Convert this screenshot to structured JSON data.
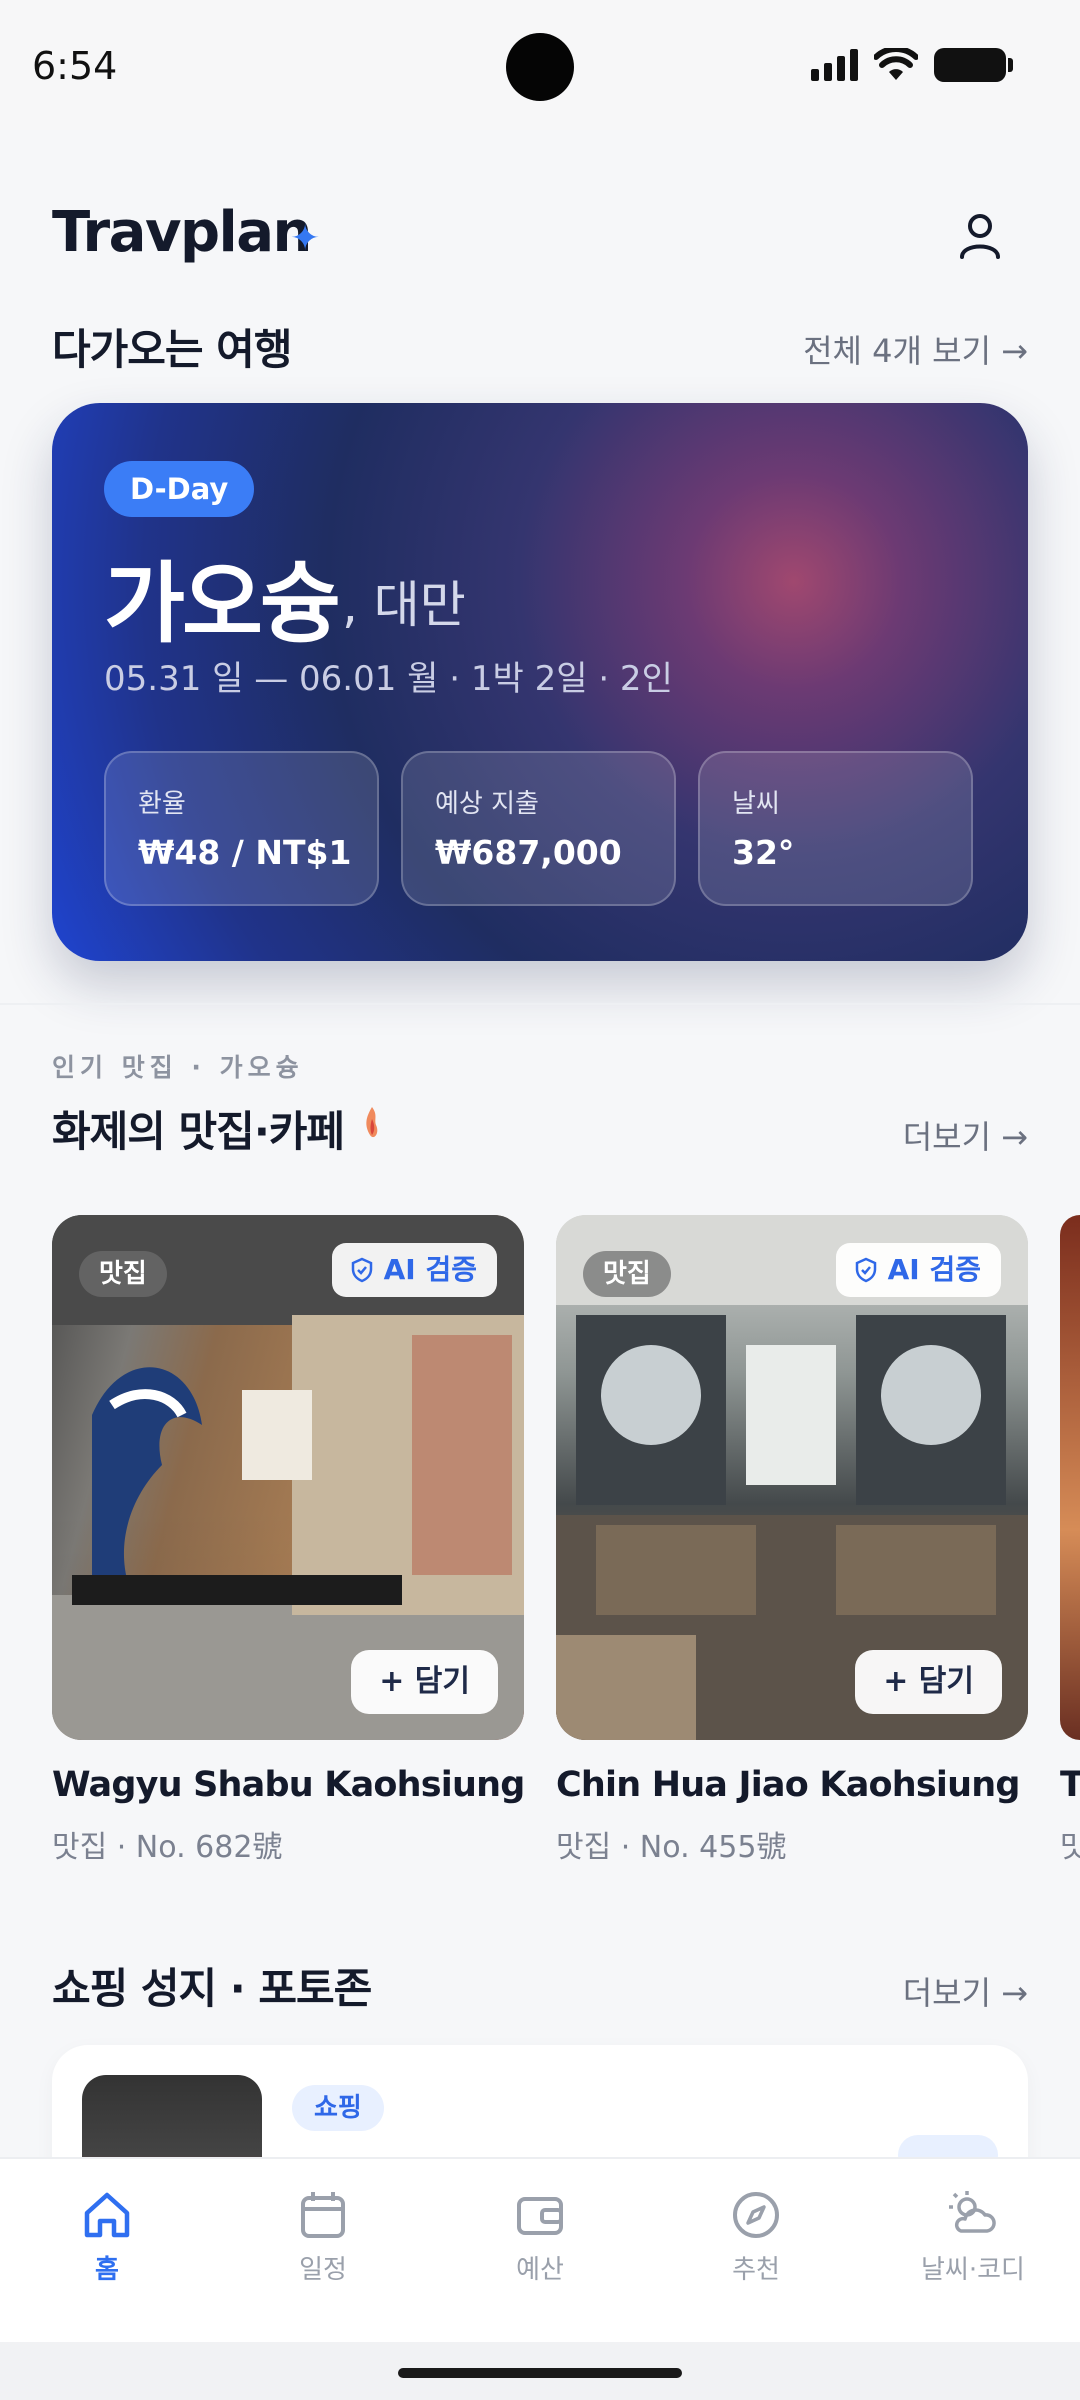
{
  "status_bar": {
    "time": "6:54"
  },
  "header": {
    "app_name": "Travplan"
  },
  "upcoming": {
    "section_title": "다가오는 여행",
    "view_all": "전체 4개 보기 →",
    "trip": {
      "badge": "D-Day",
      "city": "가오슝",
      "country": ", 대만",
      "meta": "05.31 일 — 06.01 월  ·  1박 2일  ·  2인",
      "stats": [
        {
          "label": "환율",
          "value": "₩48 / NT$1"
        },
        {
          "label": "예상 지출",
          "value": "₩687,000"
        },
        {
          "label": "날씨",
          "value": "32°"
        }
      ]
    }
  },
  "popular": {
    "eyebrow": "인기 맛집 · 가오슝",
    "section_title": "화제의 맛집·카페",
    "more": "더보기 →",
    "cards": [
      {
        "category": "맛집",
        "ai_badge": "AI 검증",
        "add": "+ 담기",
        "name": "Wagyu Shabu Kaohsiung ...",
        "meta": "맛집 · No. 682號"
      },
      {
        "category": "맛집",
        "ai_badge": "AI 검증",
        "add": "+ 담기",
        "name": "Chin Hua Jiao Kaohsiung ...",
        "meta": "맛집 · No. 455號"
      },
      {
        "name": "T",
        "meta": "맛"
      }
    ]
  },
  "shopping": {
    "section_title": "쇼핑 성지 · 포토존",
    "more": "더보기 →",
    "card": {
      "tag": "쇼핑"
    }
  },
  "tab_bar": {
    "items": [
      {
        "label": "홈",
        "icon": "home-icon",
        "active": true
      },
      {
        "label": "일정",
        "icon": "calendar-icon"
      },
      {
        "label": "예산",
        "icon": "wallet-icon"
      },
      {
        "label": "추천",
        "icon": "compass-icon"
      },
      {
        "label": "날씨·코디",
        "icon": "weather-icon"
      }
    ]
  },
  "colors": {
    "accent": "#2f6ff0",
    "text": "#141a2b",
    "muted": "#7b8190"
  }
}
